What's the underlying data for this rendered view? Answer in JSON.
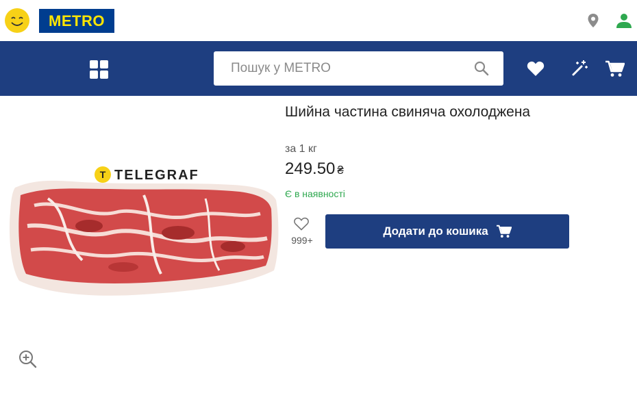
{
  "header": {
    "logo_text": "METRO",
    "colors": {
      "brand_blue": "#1e3e80",
      "logo_yellow": "#ffe600",
      "accent_green": "#2ea84f"
    },
    "icons": [
      "smiley-icon",
      "location-pin-icon",
      "user-icon"
    ]
  },
  "nav": {
    "search_placeholder": "Пошук у METRO",
    "icons": [
      "grid-menu-icon",
      "search-icon",
      "heart-icon",
      "magic-wand-icon",
      "cart-icon"
    ]
  },
  "product": {
    "title": "Шийна частина свиняча охолоджена",
    "unit": "за 1 кг",
    "price": "249.50",
    "currency": "₴",
    "availability": "Є в наявності",
    "favorites_count": "999+",
    "add_to_cart_label": "Додати до кошика",
    "watermark": "TELEGRAF"
  }
}
